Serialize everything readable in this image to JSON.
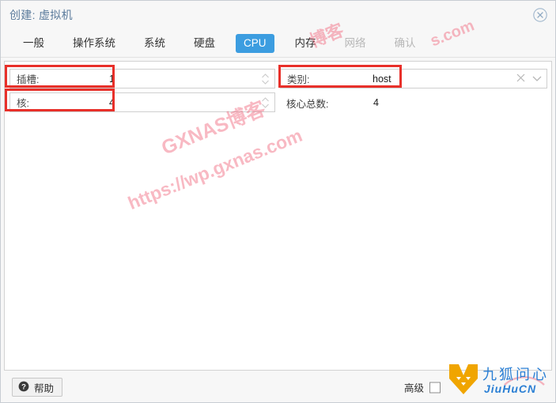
{
  "window": {
    "title": "创建: 虚拟机",
    "close_icon": "close-circle-icon",
    "accent_color": "#3c9de0",
    "title_color": "#5b7b9c"
  },
  "tabs": [
    {
      "label": "一般",
      "state": "normal"
    },
    {
      "label": "操作系统",
      "state": "normal"
    },
    {
      "label": "系统",
      "state": "normal"
    },
    {
      "label": "硬盘",
      "state": "normal"
    },
    {
      "label": "CPU",
      "state": "active"
    },
    {
      "label": "内存",
      "state": "normal"
    },
    {
      "label": "网络",
      "state": "disabled"
    },
    {
      "label": "确认",
      "state": "disabled"
    }
  ],
  "form": {
    "sockets": {
      "label": "插槽:",
      "value": "1",
      "spinner_icon": "spinner-up-down-icon",
      "highlighted": true
    },
    "cores": {
      "label": "核:",
      "value": "4",
      "spinner_icon": "spinner-up-down-icon",
      "highlighted": true
    },
    "cpu_type": {
      "label": "类别:",
      "value": "host",
      "clear_icon": "clear-x-icon",
      "dropdown_icon": "chevron-down-icon",
      "highlighted": true
    },
    "total_cores": {
      "label": "核心总数:",
      "value": "4"
    }
  },
  "footer": {
    "help_label": "帮助",
    "help_icon": "question-mark-icon",
    "advanced_label": "高级",
    "advanced_checked": false
  },
  "watermarks": {
    "brand_top": "GXNAS博客",
    "url": "https://wp.gxnas.com",
    "brand_right": "博客",
    "url_right": "s.com",
    "logo_name": "九狐问心",
    "logo_sub": "JiuHuCN",
    "logo_icon": "fox-logo-icon",
    "watermark_color": "#f05a72"
  }
}
